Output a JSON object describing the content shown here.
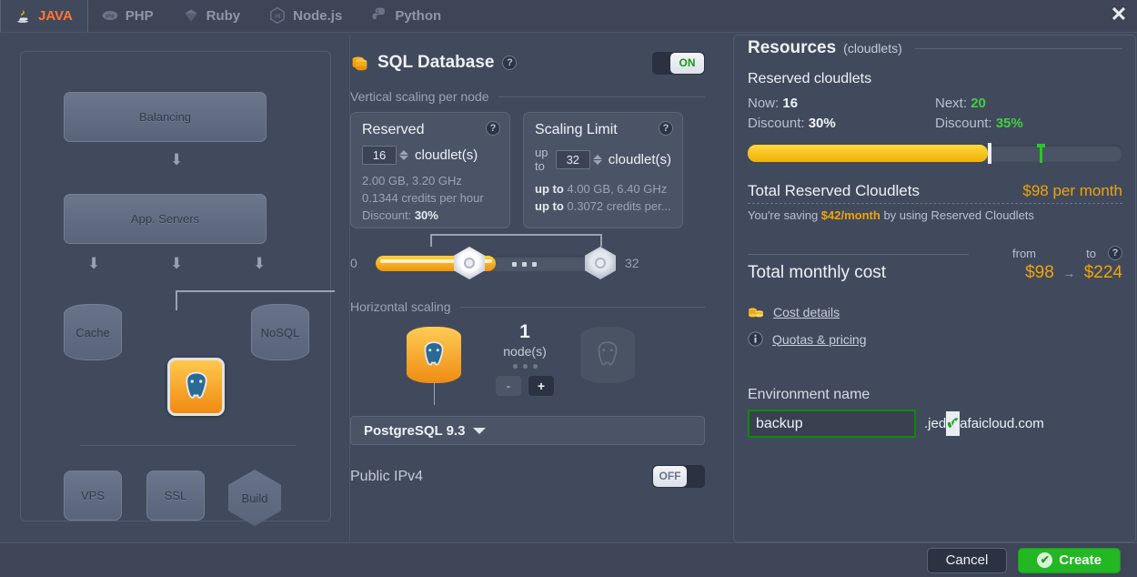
{
  "window": {
    "close_icon": "close-icon"
  },
  "tabs": [
    {
      "label": "JAVA",
      "icon": "java-icon",
      "active": true
    },
    {
      "label": "PHP",
      "icon": "php-icon",
      "active": false
    },
    {
      "label": "Ruby",
      "icon": "ruby-icon",
      "active": false
    },
    {
      "label": "Node.js",
      "icon": "nodejs-icon",
      "active": false
    },
    {
      "label": "Python",
      "icon": "python-icon",
      "active": false
    }
  ],
  "topology": {
    "balancing": "Balancing",
    "app_servers": "App. Servers",
    "cache": "Cache",
    "nosql": "NoSQL",
    "sql_selected_icon": "postgresql-icon",
    "vps": "VPS",
    "ssl": "SSL",
    "build": "Build"
  },
  "middle": {
    "title": "SQL Database",
    "title_icon": "sql-database-icon",
    "help_icon": "question-mark-icon",
    "toggle": {
      "label": "ON",
      "state": "on"
    },
    "vertical_section": "Vertical scaling per node",
    "reserved": {
      "title": "Reserved",
      "value": "16",
      "unit": "cloudlet(s)",
      "spec_ram_cpu": "2.00 GB, 3.20 GHz",
      "spec_credits": "0.1344 credits per hour",
      "discount_label": "Discount:",
      "discount_value": "30%"
    },
    "scaling_limit": {
      "title": "Scaling Limit",
      "prefix": "up to",
      "value": "32",
      "unit": "cloudlet(s)",
      "spec_ram_cpu_prefix": "up to",
      "spec_ram_cpu": "4.00 GB, 6.40 GHz",
      "spec_credits_prefix": "up to",
      "spec_credits": "0.3072 credits per..."
    },
    "slider": {
      "min": "0",
      "max": "32",
      "reserved_pos_pct": 50,
      "limit_pos_pct": 78
    },
    "horizontal_section": "Horizontal scaling",
    "nodes": {
      "count": "1",
      "unit": "node(s)",
      "minus": "-",
      "plus": "+"
    },
    "engine_select": "PostgreSQL 9.3",
    "public_ipv4": {
      "label": "Public IPv4",
      "toggle_label": "OFF",
      "state": "off"
    }
  },
  "resources": {
    "title": "Resources",
    "title_suffix": "(cloudlets)",
    "reserved_heading": "Reserved cloudlets",
    "now_label": "Now:",
    "now_value": "16",
    "now_discount_label": "Discount:",
    "now_discount_value": "30%",
    "next_label": "Next:",
    "next_value": "20",
    "next_discount_label": "Discount:",
    "next_discount_value": "35%",
    "bar": {
      "fill_pct": 64,
      "now_marker_pct": 64,
      "next_marker_pct": 78
    },
    "total_reserved_label": "Total Reserved Cloudlets",
    "total_reserved_value": "$98 per month",
    "saving_prefix": "You're saving",
    "saving_amount": "$42/month",
    "saving_suffix": "by using Reserved Cloudlets",
    "from_label": "from",
    "to_label": "to",
    "total_monthly_label": "Total monthly cost",
    "total_monthly_from": "$98",
    "total_monthly_arrow": "→",
    "total_monthly_to": "$224",
    "cost_details_link": "Cost details",
    "cost_details_icon": "coins-icon",
    "quotas_link": "Quotas & pricing",
    "quotas_icon": "info-icon",
    "env_name_label": "Environment name",
    "env_name_value": "backup",
    "env_name_placeholder": "Environment name",
    "env_valid_icon": "check-icon",
    "env_domain_suffix": ".jed.wafaicloud.com"
  },
  "footer": {
    "cancel": "Cancel",
    "create": "Create",
    "create_icon": "check-circle-icon"
  },
  "colors": {
    "accent_orange": "#f0a30a",
    "green": "#3fd03f",
    "tab_active": "#ff7733",
    "panel_bg": "#414a5c"
  }
}
